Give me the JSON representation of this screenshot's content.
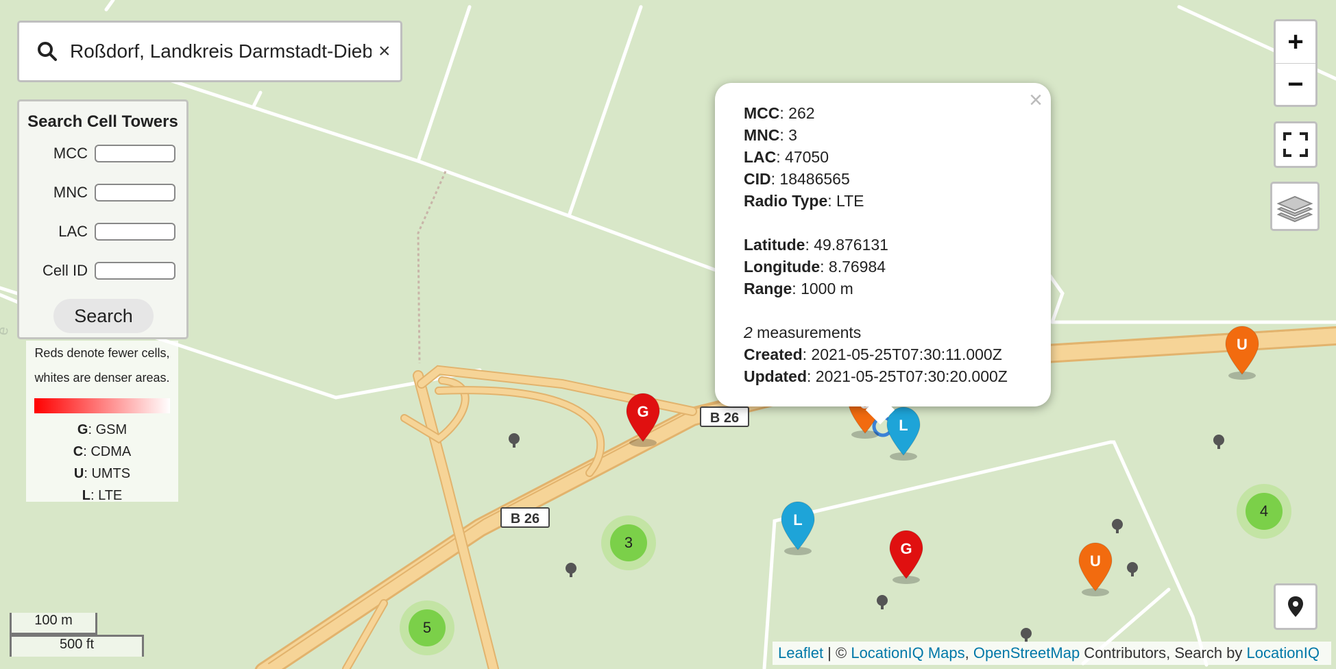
{
  "search": {
    "value": "Roßdorf, Landkreis Darmstadt-Dieburg",
    "clear_label": "×"
  },
  "cell_form": {
    "title": "Search Cell Towers",
    "fields": [
      {
        "label": "MCC",
        "value": ""
      },
      {
        "label": "MNC",
        "value": ""
      },
      {
        "label": "LAC",
        "value": ""
      },
      {
        "label": "Cell ID",
        "value": ""
      }
    ],
    "search_label": "Search"
  },
  "legend": {
    "note_line1": "Reds denote fewer cells,",
    "note_line2": "whites are denser areas.",
    "gradient_from": "#ff0000",
    "gradient_to": "#ffffff",
    "keys": [
      {
        "code": "G",
        "name": "GSM"
      },
      {
        "code": "C",
        "name": "CDMA"
      },
      {
        "code": "U",
        "name": "UMTS"
      },
      {
        "code": "L",
        "name": "LTE"
      }
    ]
  },
  "controls": {
    "zoom_in": "+",
    "zoom_out": "−",
    "fullscreen_icon": "fullscreen-icon",
    "layers_icon": "layers-icon",
    "locate_icon": "map-pin-icon"
  },
  "popup": {
    "close_label": "×",
    "fields": [
      {
        "label": "MCC",
        "value": ": 262"
      },
      {
        "label": "MNC",
        "value": ": 3"
      },
      {
        "label": "LAC",
        "value": ": 47050"
      },
      {
        "label": "CID",
        "value": ": 18486565"
      },
      {
        "label": "Radio Type",
        "value": ": LTE"
      }
    ],
    "geo": [
      {
        "label": "Latitude",
        "value": ": 49.876131"
      },
      {
        "label": "Longitude",
        "value": ": 8.76984"
      },
      {
        "label": "Range",
        "value": ": 1000 m"
      }
    ],
    "measurements_count": "2",
    "measurements_label": " measurements",
    "times": [
      {
        "label": "Created",
        "value": ": 2021-05-25T07:30:11.000Z"
      },
      {
        "label": "Updated",
        "value": ": 2021-05-25T07:30:20.000Z"
      }
    ]
  },
  "road_labels": [
    "B 26",
    "B 26"
  ],
  "clusters": [
    "3",
    "5",
    "4"
  ],
  "markers": {
    "colors": {
      "G": "#e01010",
      "U": "#f26b0f",
      "L": "#1ea4d8"
    },
    "letters": [
      "G",
      "U",
      "L",
      "U",
      "L",
      "G",
      "U"
    ]
  },
  "scale": {
    "metric": "100 m",
    "imperial": "500 ft"
  },
  "attribution": {
    "leaflet": "Leaflet",
    "sep1": " | © ",
    "locationiq_maps": "LocationIQ Maps",
    "sep2": ", ",
    "osm": "OpenStreetMap",
    "contrib": " Contributors, Search by ",
    "locationiq": "LocationIQ"
  },
  "colors": {
    "map_background": "#d8e7c8",
    "road": "#f6d497",
    "road_edge": "#e2b36d",
    "path": "#ffffff",
    "link": "#0078a8"
  }
}
